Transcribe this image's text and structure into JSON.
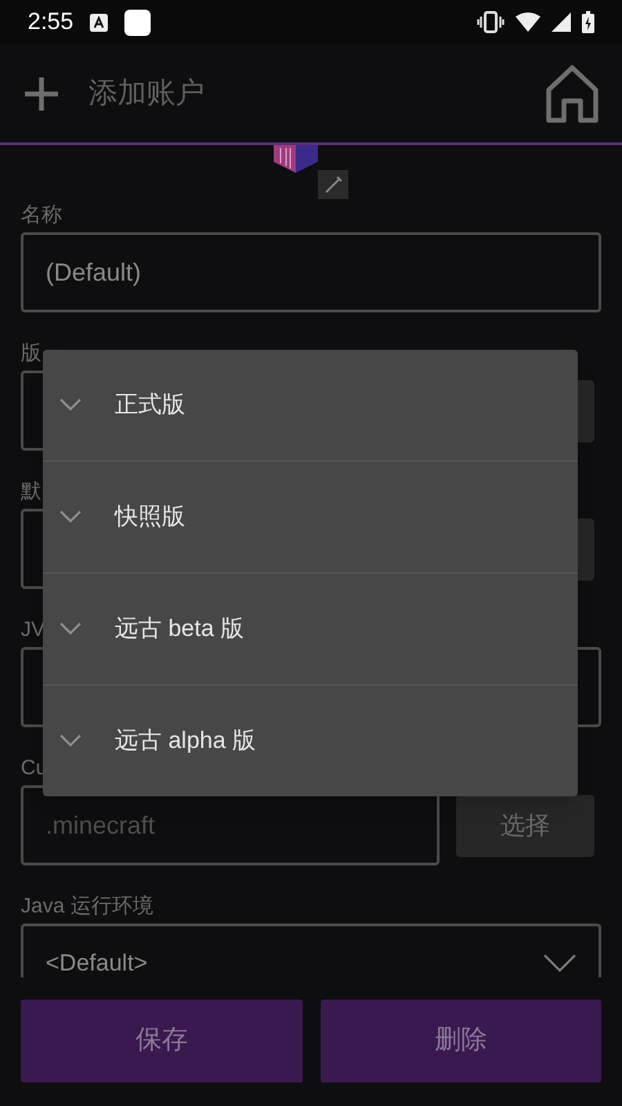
{
  "status_bar": {
    "time": "2:55"
  },
  "app_bar": {
    "title": "添加账户"
  },
  "form": {
    "fields": [
      {
        "label": "名称",
        "kind": "text",
        "value": "(Default)"
      },
      {
        "label": "版",
        "kind": "text_button"
      },
      {
        "label": "默",
        "kind": "text_button"
      },
      {
        "label": "JV",
        "kind": "text"
      },
      {
        "label": "Cu",
        "kind": "text_button",
        "placeholder": ".minecraft",
        "button": "选择"
      },
      {
        "label": "Java 运行环境",
        "kind": "select",
        "value": "<Default>"
      }
    ]
  },
  "menu": {
    "items": [
      {
        "label": "正式版"
      },
      {
        "label": "快照版"
      },
      {
        "label": "远古 beta 版"
      },
      {
        "label": "远古 alpha 版"
      }
    ]
  },
  "actions": [
    "保存",
    "删除"
  ]
}
